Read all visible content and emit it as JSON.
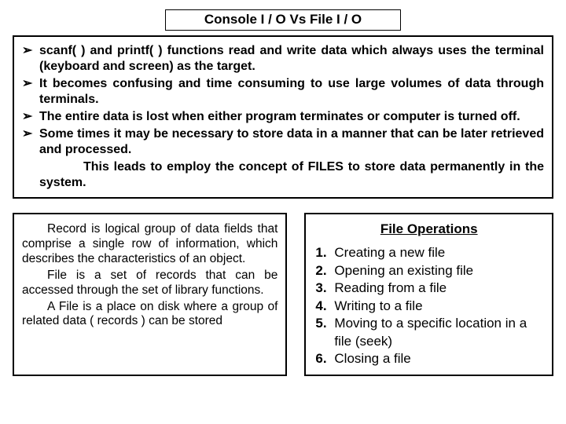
{
  "title": "Console I / O  Vs  File I / O",
  "bullets": {
    "marker": "➢",
    "b1": "scanf( ) and printf( ) functions read and write data which always uses the terminal (keyboard and screen) as the target.",
    "b2": "It becomes confusing and time consuming to use large volumes of data through terminals.",
    "b3": "The entire data is lost when either program terminates or computer is turned off.",
    "b4": "Some times it may be necessary to store data in a manner that can be later retrieved and processed.",
    "tail1": "This leads to employ the concept of FILES to store data permanently in the system."
  },
  "left": {
    "p1": "Record is logical group of data fields that comprise a single row of information, which describes the characteristics of an object.",
    "p2": "File is a set of records that can be accessed through the set of library functions.",
    "p3": "A File is a place on disk where a group of related data ( records ) can be stored"
  },
  "right": {
    "heading": "File Operations",
    "ops": [
      {
        "n": "1.",
        "t": "Creating a new file"
      },
      {
        "n": "2.",
        "t": "Opening an existing file"
      },
      {
        "n": "3.",
        "t": "Reading from a file"
      },
      {
        "n": "4.",
        "t": "Writing to a file"
      },
      {
        "n": "5.",
        "t": "Moving to a specific location in a file (seek)"
      },
      {
        "n": "6.",
        "t": "Closing a file"
      }
    ]
  }
}
